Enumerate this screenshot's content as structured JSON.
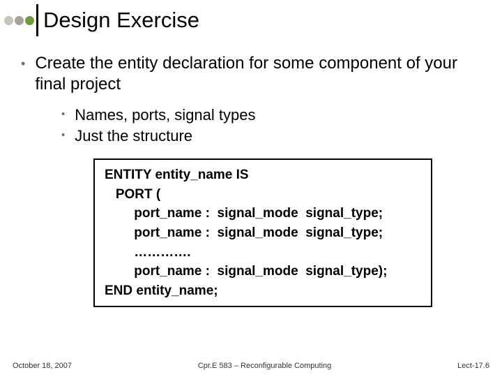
{
  "title": "Design Exercise",
  "bullets": {
    "main": "Create the entity declaration for some component of your final project",
    "subs": [
      "Names, ports, signal types",
      "Just the structure"
    ]
  },
  "code": "ENTITY entity_name IS\n   PORT (\n        port_name :  signal_mode  signal_type;\n        port_name :  signal_mode  signal_type;\n        ………….\n        port_name :  signal_mode  signal_type);\nEND entity_name;",
  "footer": {
    "left": "October 18, 2007",
    "center": "Cpr.E 583 – Reconfigurable Computing",
    "right": "Lect-17.6"
  }
}
